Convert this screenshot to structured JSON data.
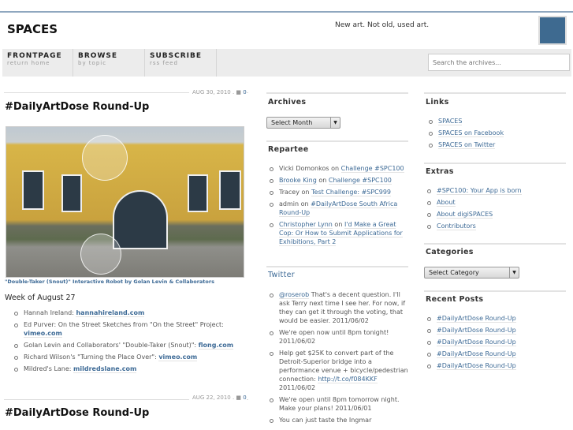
{
  "header": {
    "title": "SPACES",
    "tagline": "New art. Not old, used art.",
    "search_placeholder": "Search the archives..."
  },
  "nav": [
    {
      "label": "FRONTPAGE",
      "sub": "return home"
    },
    {
      "label": "BROWSE",
      "sub": "by topic"
    },
    {
      "label": "SUBSCRIBE",
      "sub": "rss feed"
    }
  ],
  "posts": [
    {
      "date": "AUG 30, 2010",
      "comments": "0",
      "title": "#DailyArtDose Round-Up",
      "caption": "\"Double-Taker (Snout)\" Interactive Robot by Golan Levin & Collaborators",
      "week": "Week of August 27",
      "items": [
        {
          "text": "Hannah Ireland: ",
          "link": "hannahireland.com"
        },
        {
          "text": "Ed Purver: On the Street Sketches from \"On the Street\" Project: ",
          "link": "vimeo.com"
        },
        {
          "text": "Golan Levin and Collaborators' \"Double-Taker (Snout)\": ",
          "link": "flong.com"
        },
        {
          "text": "Richard Wilson's \"Turning the Place Over\": ",
          "link": "vimeo.com"
        },
        {
          "text": "Mildred's Lane: ",
          "link": "mildredslane.com"
        }
      ]
    },
    {
      "date": "AUG 22, 2010",
      "comments": "0",
      "title": "#DailyArtDose Round-Up"
    }
  ],
  "archives": {
    "title": "Archives",
    "select": "Select Month"
  },
  "repartee": {
    "title": "Repartee",
    "items": [
      {
        "author": "Vicki Domonkos",
        "author_link": false,
        "on": " on ",
        "post": "Challenge #SPC100"
      },
      {
        "author": "Brooke King",
        "author_link": true,
        "on": " on ",
        "post": "Challenge #SPC100"
      },
      {
        "author": "Tracey",
        "author_link": false,
        "on": " on ",
        "post": "Test Challenge: #SPC999"
      },
      {
        "author": "admin",
        "author_link": false,
        "on": " on ",
        "post": "#DailyArtDose South Africa Round-Up"
      },
      {
        "author": "Christopher Lynn",
        "author_link": true,
        "on": " on ",
        "post": "I'd Make a Great Cop: Or How to Submit Applications for Exhibitions, Part 2"
      }
    ]
  },
  "twitter": {
    "title": "Twitter",
    "items": [
      {
        "pre": "",
        "link": "@roserob",
        "text": " That's a decent question. I'll ask Terry next time I see her. For now, if they can get it through the voting, that would be easier. 2011/06/02"
      },
      {
        "pre": "We're open now until 8pm tonight! 2011/06/02",
        "link": "",
        "text": ""
      },
      {
        "pre": "Help get $25K to convert part of the Detroit-Superior bridge into a performance venue + bicycle/pedestrian connection: ",
        "link": "http://t.co/f084KKF",
        "text": " 2011/06/02"
      },
      {
        "pre": "We're open until 8pm tomorrow night. Make your plans! 2011/06/01",
        "link": "",
        "text": ""
      },
      {
        "pre": "You can just taste the Ingmar",
        "link": "",
        "text": ""
      }
    ]
  },
  "links": {
    "title": "Links",
    "items": [
      "SPACES",
      "SPACES on Facebook",
      "SPACES on Twitter"
    ]
  },
  "extras": {
    "title": "Extras",
    "items": [
      "#SPC100: Your App is born",
      "About",
      "About digiSPACES",
      "Contributors"
    ]
  },
  "categories": {
    "title": "Categories",
    "select": "Select Category"
  },
  "recent": {
    "title": "Recent Posts",
    "items": [
      "#DailyArtDose Round-Up",
      "#DailyArtDose Round-Up",
      "#DailyArtDose Round-Up",
      "#DailyArtDose Round-Up",
      "#DailyArtDose Round-Up"
    ]
  }
}
